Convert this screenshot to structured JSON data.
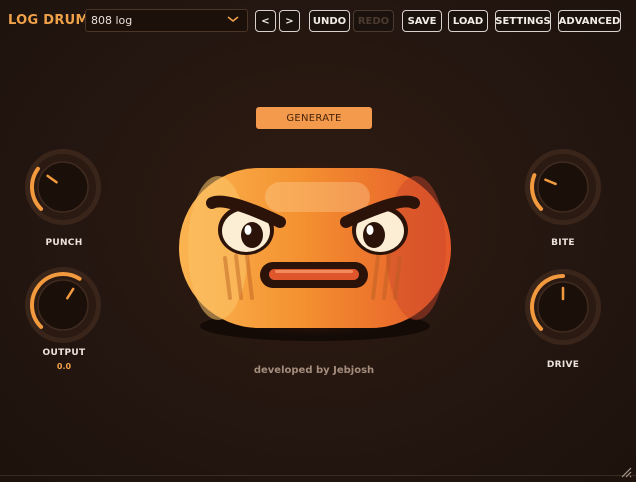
{
  "header": {
    "app_title": "LOG DRUM",
    "preset_name": "808 log",
    "prev_label": "<",
    "next_label": ">",
    "undo_label": "UNDO",
    "redo_label": "REDO",
    "save_label": "SAVE",
    "load_label": "LOAD",
    "settings_label": "SETTINGS",
    "advanced_label": "ADVANCED"
  },
  "generate_label": "GENERATE",
  "knobs": {
    "punch": {
      "label": "PUNCH",
      "level": 0.3
    },
    "output": {
      "label": "OUTPUT",
      "value": "0.0",
      "level": 0.62
    },
    "bite": {
      "label": "BITE",
      "level": 0.25
    },
    "drive": {
      "label": "DRIVE",
      "level": 0.5
    }
  },
  "credit": "developed by Jebjosh",
  "colors": {
    "accent": "#f0a24a",
    "background": "#241610",
    "button_border": "#d9d2cc"
  }
}
